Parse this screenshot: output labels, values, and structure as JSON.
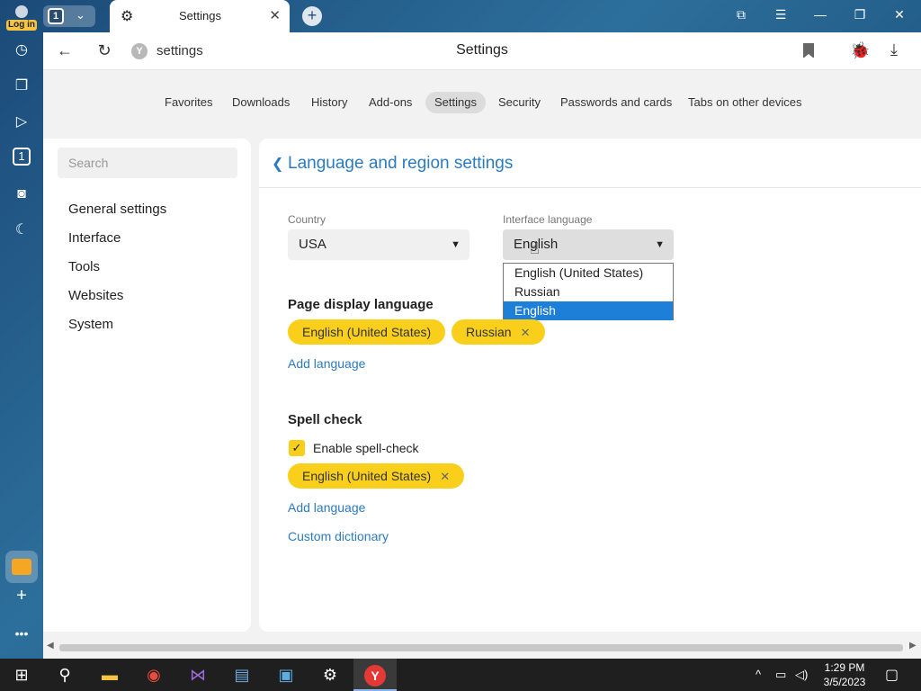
{
  "titlebar": {
    "login_label": "Log in",
    "tab_count": "1",
    "active_tab_title": "Settings",
    "close_tab": "✕",
    "new_tab": "+",
    "controls": [
      "⧉",
      "☰",
      "—",
      "❐",
      "✕"
    ]
  },
  "sidepanel": {
    "icons": [
      "history-icon",
      "collections-icon",
      "play-icon",
      "tab-number-icon",
      "camera-icon",
      "night-mode-icon",
      "mail-icon",
      "add-icon",
      "more-icon"
    ],
    "tab_number": "1"
  },
  "addressbar": {
    "url": "settings",
    "page_title": "Settings"
  },
  "navtabs": [
    "Favorites",
    "Downloads",
    "History",
    "Add-ons",
    "Settings",
    "Security",
    "Passwords and cards",
    "Tabs on other devices"
  ],
  "active_navtab": "Settings",
  "sidebar": {
    "search_placeholder": "Search",
    "items": [
      "General settings",
      "Interface",
      "Tools",
      "Websites",
      "System"
    ]
  },
  "main": {
    "section_title": "Language and region settings",
    "country_label": "Country",
    "country_value": "USA",
    "interface_language_label": "Interface language",
    "interface_language_value": "English",
    "dropdown_options": [
      "English (United States)",
      "Russian",
      "English"
    ],
    "dropdown_selected": "English",
    "page_display_heading": "Page display language",
    "page_display_chips": [
      "English (United States)",
      "Russian"
    ],
    "add_language_1": "Add language",
    "spell_check_heading": "Spell check",
    "enable_spellcheck_label": "Enable spell-check",
    "enable_spellcheck_checked": true,
    "spellcheck_chips": [
      "English (United States)"
    ],
    "add_language_2": "Add language",
    "custom_dictionary": "Custom dictionary"
  },
  "taskbar": {
    "apps": [
      "start-icon",
      "search-icon",
      "file-explorer-icon",
      "chrome-icon",
      "visual-studio-icon",
      "app-icon",
      "app-icon-2",
      "settings-icon",
      "yandex-browser-icon"
    ],
    "time": "1:29 PM",
    "date": "3/5/2023"
  },
  "colors": {
    "accent": "#2b7bc0",
    "chip": "#f9cf1c",
    "selection": "#1e7fd9"
  }
}
